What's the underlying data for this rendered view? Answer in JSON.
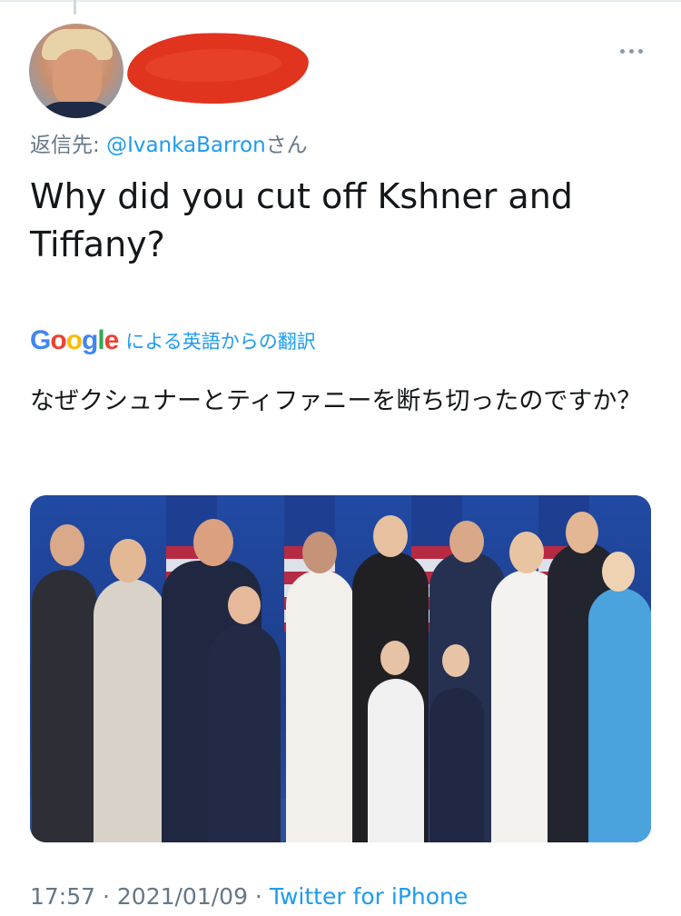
{
  "reply": {
    "prefix": "返信先: ",
    "mention": "@IvankaBarron",
    "suffix": "さん"
  },
  "tweet": {
    "text": "Why did you cut off Kshner and Tiffany?"
  },
  "translation": {
    "logo": {
      "G": "G",
      "o1": "o",
      "o2": "o",
      "g": "g",
      "l": "l",
      "e": "e"
    },
    "label": "による英語からの翻訳",
    "text": "なぜクシュナーとティファニーを断ち切ったのですか？"
  },
  "meta": {
    "time": "17:57",
    "sep1": " · ",
    "date": "2021/01/09",
    "sep2": " · ",
    "source": "Twitter for iPhone"
  },
  "icons": {
    "more": "more-horizontal-icon"
  },
  "colors": {
    "link": "#1d9bf0",
    "muted": "#657786",
    "redaction": "#e0341f"
  }
}
